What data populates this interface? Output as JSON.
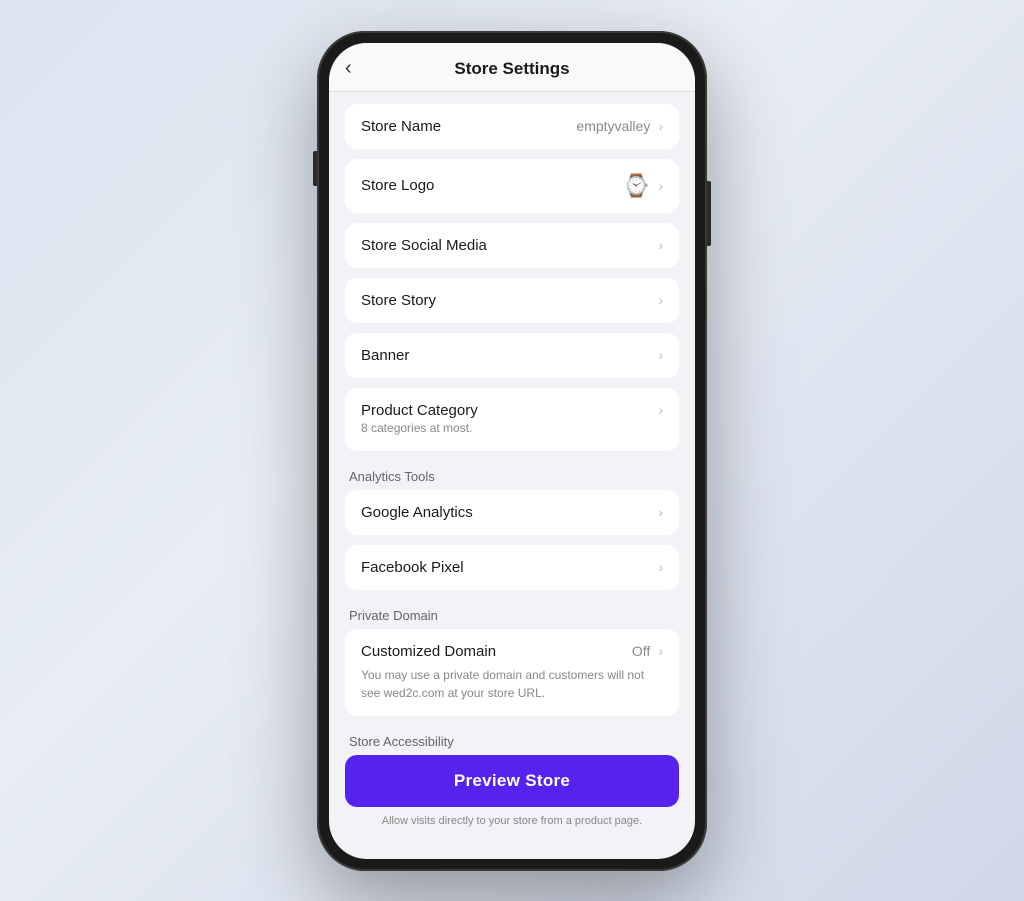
{
  "header": {
    "back_icon": "‹",
    "title": "Store Settings"
  },
  "settings": {
    "items": [
      {
        "id": "store-name",
        "label": "Store Name",
        "value": "emptyvalley",
        "has_chevron": true
      },
      {
        "id": "store-logo",
        "label": "Store Logo",
        "value": "",
        "has_icon": true,
        "has_chevron": true
      },
      {
        "id": "store-social-media",
        "label": "Store Social Media",
        "value": "",
        "has_chevron": true
      },
      {
        "id": "store-story",
        "label": "Store Story",
        "value": "",
        "has_chevron": true
      },
      {
        "id": "banner",
        "label": "Banner",
        "value": "",
        "has_chevron": true
      },
      {
        "id": "product-category",
        "label": "Product Category",
        "subtitle": "8 categories at most.",
        "has_chevron": true
      }
    ],
    "analytics_section": "Analytics Tools",
    "analytics_items": [
      {
        "id": "google-analytics",
        "label": "Google Analytics",
        "has_chevron": true
      },
      {
        "id": "facebook-pixel",
        "label": "Facebook Pixel",
        "has_chevron": true
      }
    ],
    "domain_section": "Private Domain",
    "domain_item": {
      "label": "Customized Domain",
      "value": "Off",
      "description": "You may use a private domain and customers will not see wed2c.com at your store URL.",
      "has_chevron": true
    },
    "accessibility_section": "Store Accessibility",
    "preview_button": "Preview Store",
    "accessibility_desc": "Allow visits directly to your store from a product page."
  }
}
